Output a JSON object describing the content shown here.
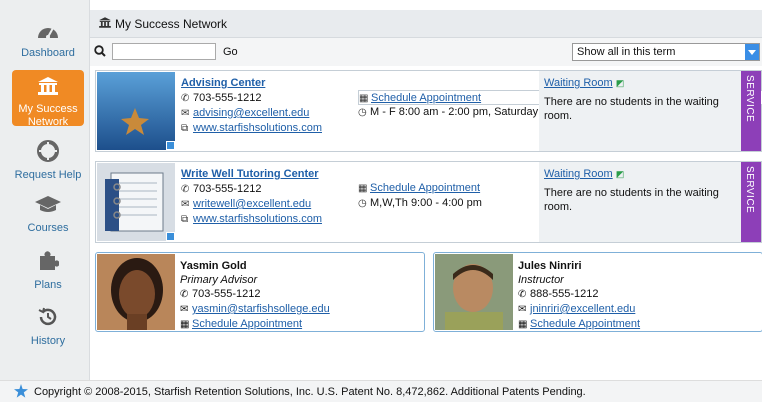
{
  "nav": [
    {
      "label": "Dashboard",
      "icon": "gauge-icon"
    },
    {
      "label": "My Success Network",
      "label_line1": "My Success",
      "label_line2": "Network",
      "icon": "bank-icon",
      "active": true
    },
    {
      "label": "Request Help",
      "icon": "lifebuoy-icon"
    },
    {
      "label": "Courses",
      "icon": "graduation-cap-icon"
    },
    {
      "label": "Plans",
      "icon": "puzzle-icon"
    },
    {
      "label": "History",
      "icon": "history-icon"
    }
  ],
  "header": {
    "title": "My Success Network"
  },
  "search": {
    "value": "",
    "go_label": "Go"
  },
  "filter": {
    "selected": "Show all in this term"
  },
  "services": [
    {
      "name": "Advising Center",
      "phone": "703-555-1212",
      "email": "advising@excellent.edu",
      "website": "www.starfishsolutions.com",
      "appointment": "Schedule Appointment",
      "hours": "M - F 8:00 am - 2:00 pm, Saturday…",
      "waiting_room_label": "Waiting Room",
      "waiting_room_text": "There are no students in the waiting room.",
      "tag": "SERVICE"
    },
    {
      "name": "Write Well Tutoring Center",
      "phone": "703-555-1212",
      "email": "writewell@excellent.edu",
      "website": "www.starfishsolutions.com",
      "appointment": "Schedule Appointment",
      "hours": "M,W,Th 9:00 - 4:00 pm",
      "waiting_room_label": "Waiting Room",
      "waiting_room_text": "There are no students in the waiting room.",
      "tag": "SERVICE"
    }
  ],
  "people": [
    {
      "name": "Yasmin Gold",
      "role": "Primary Advisor",
      "phone": "703-555-1212",
      "email": "yasmin@starfishsollege.edu",
      "appointment": "Schedule Appointment"
    },
    {
      "name": "Jules Ninriri",
      "role": "Instructor",
      "phone": "888-555-1212",
      "email": "jninriri@excellent.edu",
      "appointment": "Schedule Appointment"
    }
  ],
  "footer": {
    "text": "Copyright © 2008-2015, Starfish Retention Solutions, Inc. U.S. Patent No. 8,472,862. Additional Patents Pending."
  },
  "colors": {
    "accent": "#f08a24",
    "link": "#1f5fa8",
    "service_tag": "#8d3fb8"
  }
}
